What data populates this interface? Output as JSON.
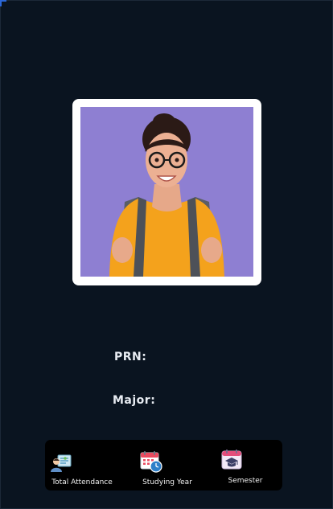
{
  "profile": {
    "photo_alt": "student-photo",
    "prn_label": "PRN:",
    "prn_value": "",
    "major_label": "Major:",
    "major_value": ""
  },
  "stats": [
    {
      "label": "Total Attendance",
      "icon": "attendance-icon"
    },
    {
      "label": "Studying Year",
      "icon": "calendar-clock-icon"
    },
    {
      "label": "Semester",
      "icon": "graduation-calendar-icon"
    }
  ],
  "colors": {
    "background": "#0a1420",
    "stats_bar": "#000000",
    "photo_backdrop": "#8e7fd2",
    "card": "#ffffff"
  }
}
